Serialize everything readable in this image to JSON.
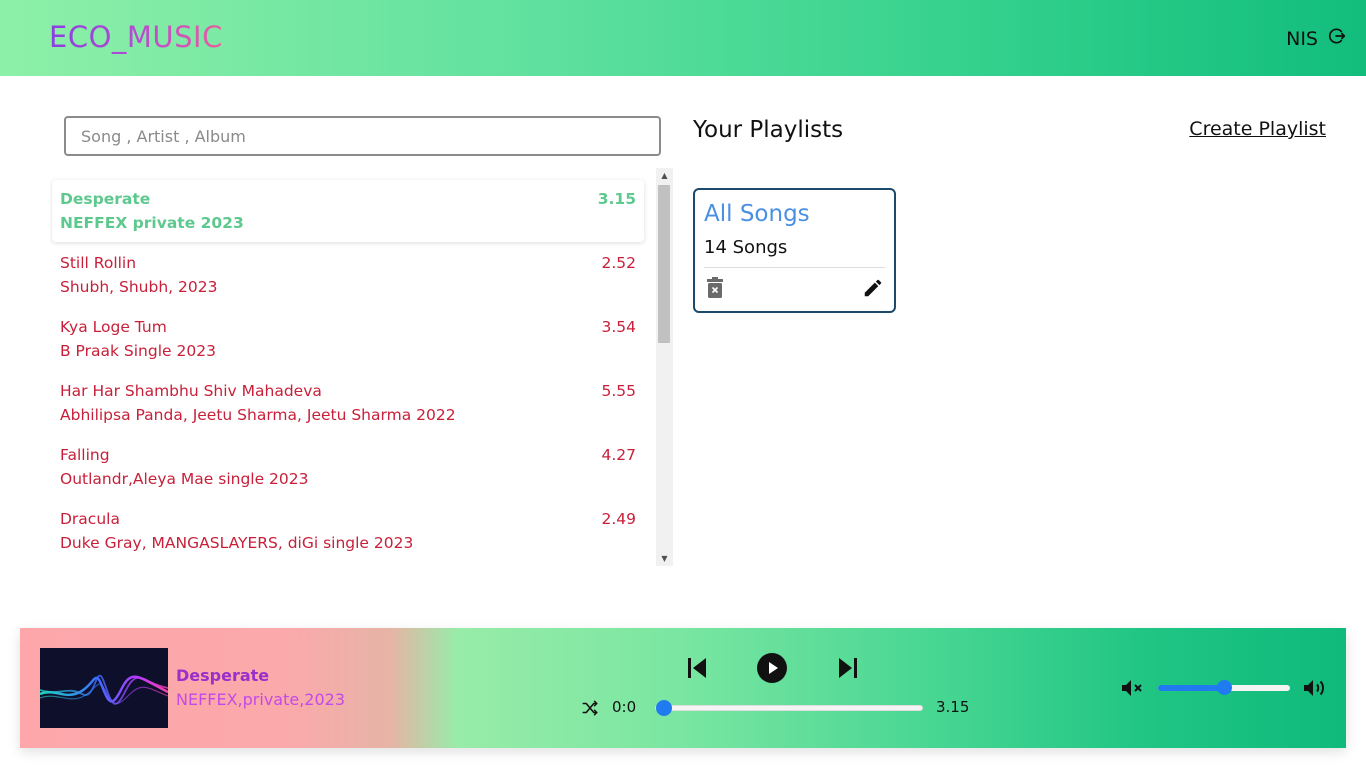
{
  "header": {
    "logo": "ECO_MUSIC",
    "user": "NIS"
  },
  "search": {
    "placeholder": "Song , Artist , Album"
  },
  "songs": [
    {
      "title": "Desperate",
      "subtitle": "NEFFEX private 2023",
      "duration": "3.15",
      "active": true
    },
    {
      "title": "Still Rollin",
      "subtitle": "Shubh, Shubh, 2023",
      "duration": "2.52",
      "active": false
    },
    {
      "title": "Kya Loge Tum",
      "subtitle": "B Praak Single 2023",
      "duration": "3.54",
      "active": false
    },
    {
      "title": "Har Har Shambhu Shiv Mahadeva",
      "subtitle": "Abhilipsa Panda, Jeetu Sharma, Jeetu Sharma 2022",
      "duration": "5.55",
      "active": false
    },
    {
      "title": "Falling",
      "subtitle": "Outlandr,Aleya Mae single 2023",
      "duration": "4.27",
      "active": false
    },
    {
      "title": "Dracula",
      "subtitle": "Duke Gray, MANGASLAYERS, diGi single 2023",
      "duration": "2.49",
      "active": false
    }
  ],
  "playlists": {
    "title": "Your Playlists",
    "create_label": "Create Playlist",
    "items": [
      {
        "name": "All Songs",
        "count": "14 Songs"
      }
    ]
  },
  "player": {
    "title": "Desperate",
    "subtitle": "NEFFEX,private,2023",
    "current_time": "0:0",
    "total_time": "3.15",
    "progress": 0,
    "volume": 0.5
  },
  "colors": {
    "song_text": "#c8203a",
    "active_song": "#5ec98e",
    "playlist_name": "#4a90e2",
    "slider": "#1f7bef"
  }
}
